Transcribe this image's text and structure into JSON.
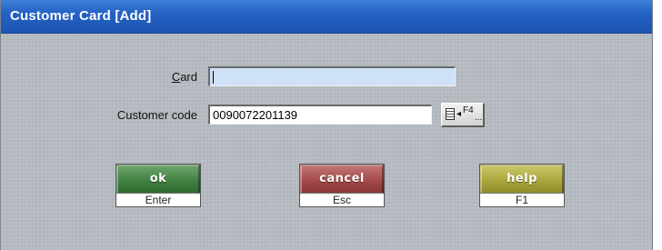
{
  "window": {
    "title": "Customer Card  [Add]"
  },
  "form": {
    "card": {
      "label_mnemonic": "C",
      "label_rest": "ard",
      "value": ""
    },
    "customer_code": {
      "label": "Customer code",
      "value": "0090072201139"
    },
    "lookup_button": {
      "key": "F4",
      "dots": "..."
    }
  },
  "buttons": {
    "ok": {
      "label": "ok",
      "shortcut": "Enter"
    },
    "cancel": {
      "label": "cancel",
      "shortcut": "Esc"
    },
    "help": {
      "label": "help",
      "shortcut": "F1"
    }
  },
  "colors": {
    "titlebar": "#2462c4",
    "ok": "#3f7d3f",
    "cancel": "#a04646",
    "help": "#a6a33a",
    "card_field_bg": "#cfe1f7"
  },
  "icons": {
    "lookup": "document-list-arrow-icon"
  }
}
